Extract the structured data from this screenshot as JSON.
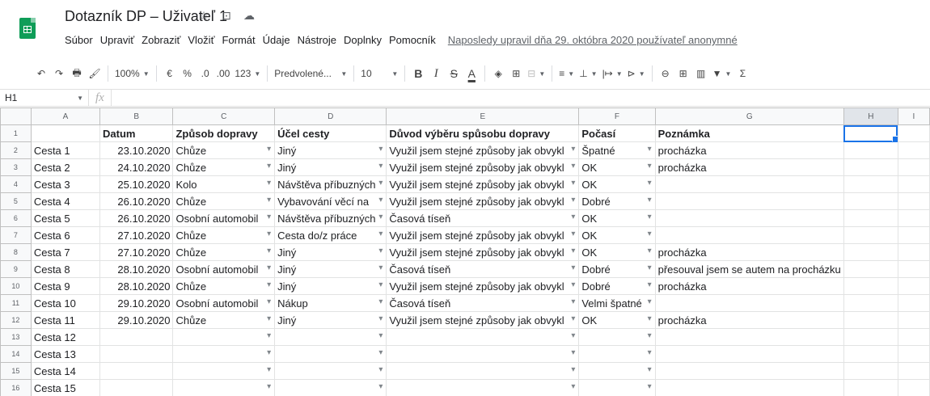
{
  "doc": {
    "title": "Dotazník DP – Uživateľ 1",
    "icons": [
      "star-icon",
      "move-to-folder-icon",
      "cloud-status-icon"
    ]
  },
  "menu": {
    "items": [
      "Súbor",
      "Upraviť",
      "Zobraziť",
      "Vložiť",
      "Formát",
      "Údaje",
      "Nástroje",
      "Doplnky",
      "Pomocník"
    ],
    "last_edit": "Naposledy upravil dňa 29. októbra 2020 používateľ anonymné"
  },
  "toolbar": {
    "undo": "↶",
    "redo": "↷",
    "print": "🖶",
    "paint_format": "🖌",
    "zoom": "100%",
    "currency": "€",
    "percent": "%",
    "dec_decrease": ".0",
    "dec_increase": ".00",
    "more_formats": "123",
    "font": "Predvolené...",
    "font_size": "10",
    "bold": "B",
    "italic": "I",
    "strike": "S",
    "text_color": "A",
    "fill": "◈",
    "borders": "⊞",
    "merge": "⊟",
    "halign": "≡",
    "valign": "⊥",
    "wrap": "|↦",
    "rotate": "⊳",
    "link": "⊖",
    "comment": "⊞",
    "chart": "▥",
    "filter": "▼",
    "functions": "Σ"
  },
  "formula_bar": {
    "cell_ref": "H1",
    "fx": "fx",
    "value": ""
  },
  "grid": {
    "columns": [
      "A",
      "B",
      "C",
      "D",
      "E",
      "F",
      "G",
      "H",
      "I"
    ],
    "selected_column": "H",
    "header_row": [
      "",
      "Datum",
      "Způsob dopravy",
      "Účel cesty",
      "Důvod výběru spůsobu dopravy",
      "Počasí",
      "Poznámka",
      "",
      ""
    ],
    "rows": [
      [
        "Cesta 1",
        "23.10.2020",
        "Chůze",
        "Jiný",
        "Využil jsem stejné způsoby jak obvykl",
        "Špatné",
        "procházka",
        "",
        ""
      ],
      [
        "Cesta 2",
        "24.10.2020",
        "Chůze",
        "Jiný",
        "Využil jsem stejné způsoby jak obvykl",
        "OK",
        "procházka",
        "",
        ""
      ],
      [
        "Cesta 3",
        "25.10.2020",
        "Kolo",
        "Návštěva příbuzných",
        "Využil jsem stejné způsoby jak obvykl",
        "OK",
        "",
        "",
        ""
      ],
      [
        "Cesta 4",
        "26.10.2020",
        "Chůze",
        "Vybavování věcí na",
        "Využil jsem stejné způsoby jak obvykl",
        "Dobré",
        "",
        "",
        ""
      ],
      [
        "Cesta 5",
        "26.10.2020",
        "Osobní automobil",
        "Návštěva příbuzných",
        "Časová tíseň",
        "OK",
        "",
        "",
        ""
      ],
      [
        "Cesta 6",
        "27.10.2020",
        "Chůze",
        "Cesta do/z práce",
        "Využil jsem stejné způsoby jak obvykl",
        "OK",
        "",
        "",
        ""
      ],
      [
        "Cesta 7",
        "27.10.2020",
        "Chůze",
        "Jiný",
        "Využil jsem stejné způsoby jak obvykl",
        "OK",
        "procházka",
        "",
        ""
      ],
      [
        "Cesta 8",
        "28.10.2020",
        "Osobní automobil",
        "Jiný",
        "Časová tíseň",
        "Dobré",
        "přesouval jsem se autem na procházku",
        "",
        ""
      ],
      [
        "Cesta 9",
        "28.10.2020",
        "Chůze",
        "Jiný",
        "Využil jsem stejné způsoby jak obvykl",
        "Dobré",
        "procházka",
        "",
        ""
      ],
      [
        "Cesta 10",
        "29.10.2020",
        "Osobní automobil",
        "Nákup",
        "Časová tíseň",
        "Velmi špatné",
        "",
        "",
        ""
      ],
      [
        "Cesta 11",
        "29.10.2020",
        "Chůze",
        "Jiný",
        "Využil jsem stejné způsoby jak obvykl",
        "OK",
        "procházka",
        "",
        ""
      ],
      [
        "Cesta 12",
        "",
        "",
        "",
        "",
        "",
        "",
        "",
        ""
      ],
      [
        "Cesta 13",
        "",
        "",
        "",
        "",
        "",
        "",
        "",
        ""
      ],
      [
        "Cesta 14",
        "",
        "",
        "",
        "",
        "",
        "",
        "",
        ""
      ],
      [
        "Cesta 15",
        "",
        "",
        "",
        "",
        "",
        "",
        "",
        ""
      ]
    ]
  }
}
